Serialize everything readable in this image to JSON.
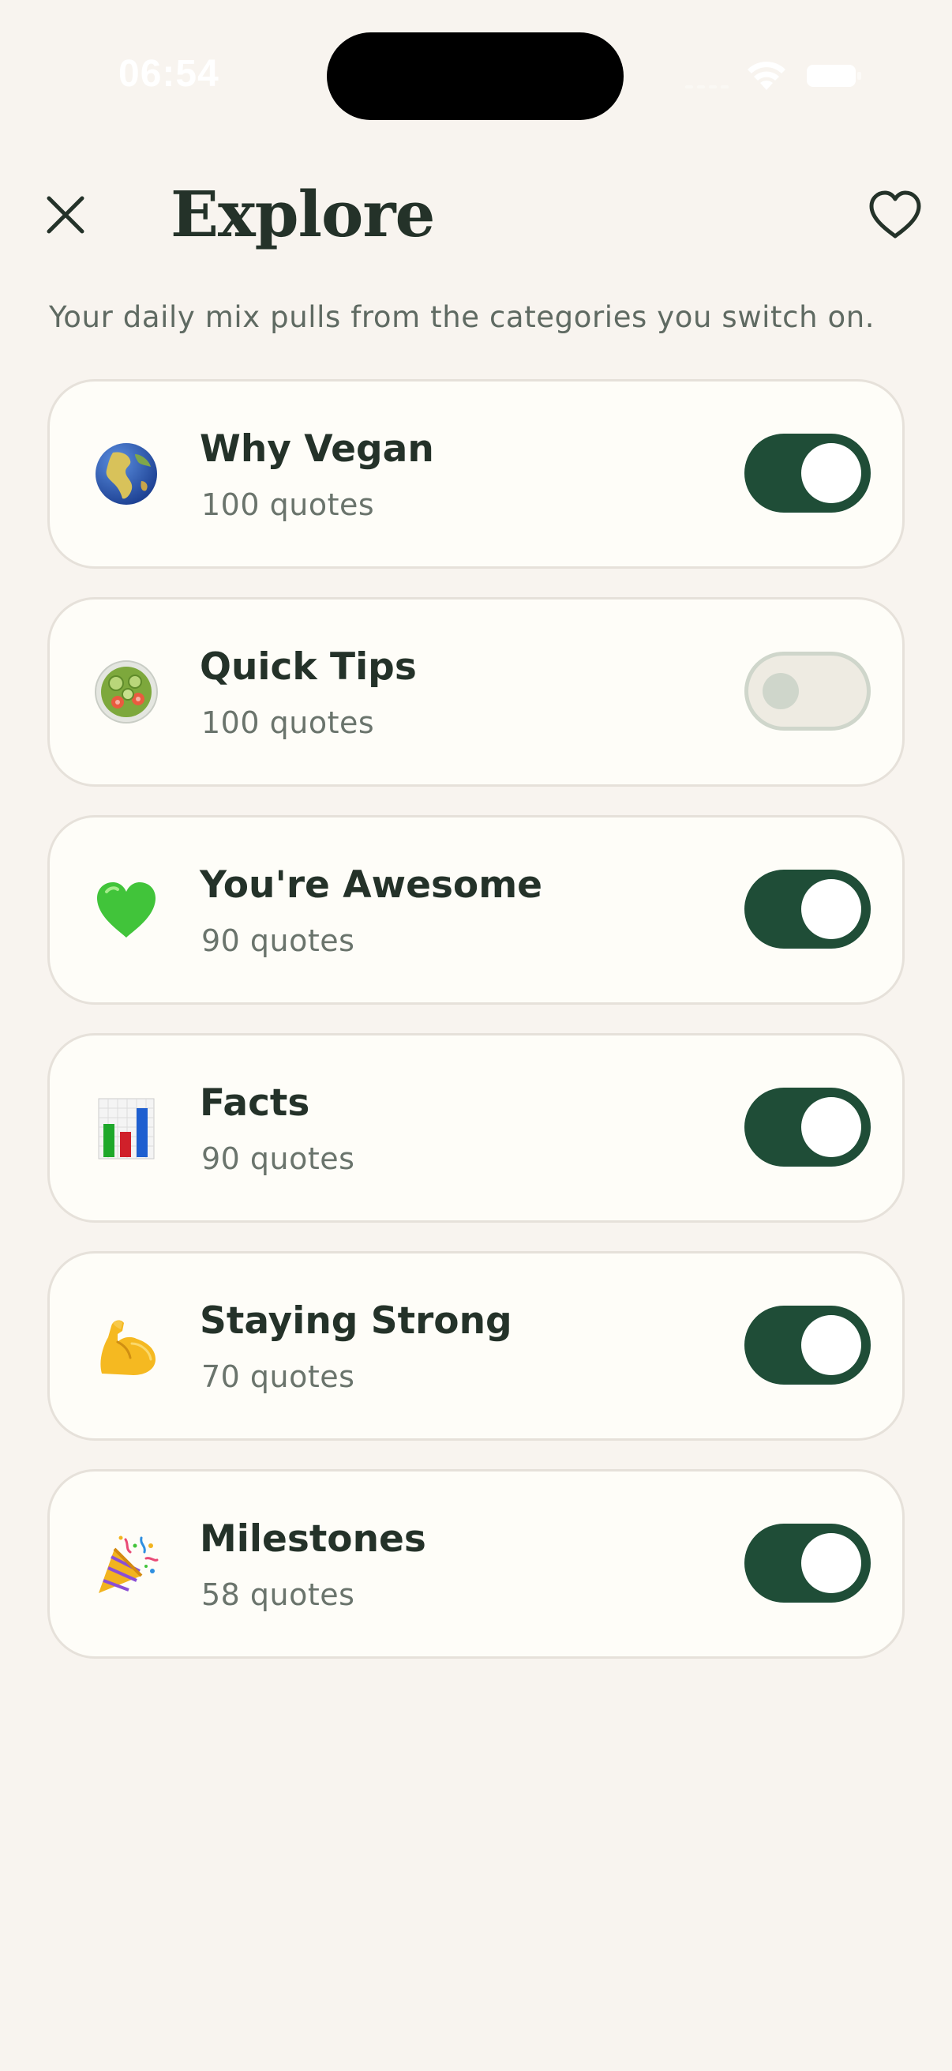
{
  "status_bar": {
    "time": "06:54",
    "icons": [
      "cellular-signal-icon",
      "wifi-icon",
      "battery-icon"
    ]
  },
  "header": {
    "title": "Explore",
    "close_icon": "close-icon",
    "favorites_icon": "heart-icon"
  },
  "subtitle": "Your daily mix pulls from the categories you switch on.",
  "categories": [
    {
      "name": "Why Vegan",
      "count": "100 quotes",
      "icon": "globe-icon",
      "enabled": true
    },
    {
      "name": "Quick Tips",
      "count": "100 quotes",
      "icon": "salad-icon",
      "enabled": false
    },
    {
      "name": "You're Awesome",
      "count": "90 quotes",
      "icon": "green-heart-icon",
      "enabled": true
    },
    {
      "name": "Facts",
      "count": "90 quotes",
      "icon": "bar-chart-icon",
      "enabled": true
    },
    {
      "name": "Staying Strong",
      "count": "70 quotes",
      "icon": "flexed-biceps-icon",
      "enabled": true
    },
    {
      "name": "Milestones",
      "count": "58 quotes",
      "icon": "party-popper-icon",
      "enabled": true
    }
  ],
  "colors": {
    "background": "#f8f4ef",
    "card": "#fefdf8",
    "accent": "#1f4d37",
    "text": "#243229",
    "muted_text": "#5f6a62",
    "toggle_off": "#eeebe2"
  }
}
